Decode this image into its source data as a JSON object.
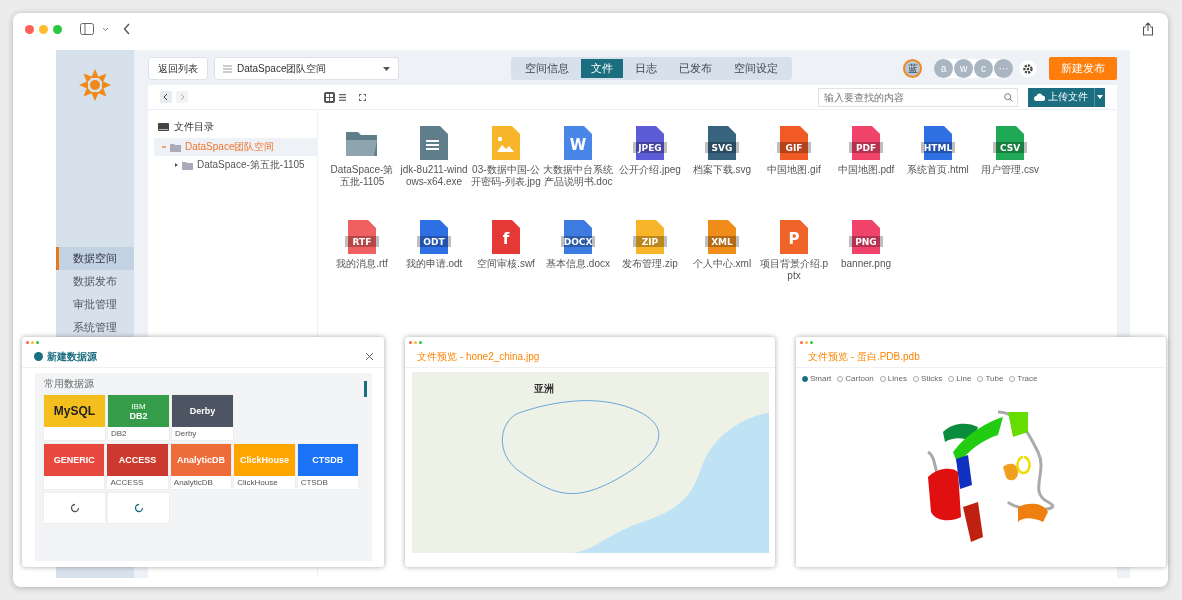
{
  "nav": {
    "items": [
      {
        "label": "数据空间",
        "selected": true
      },
      {
        "label": "数据发布",
        "selected": false
      },
      {
        "label": "审批管理",
        "selected": false
      },
      {
        "label": "系统管理",
        "selected": false
      }
    ]
  },
  "header": {
    "back_button": "返回列表",
    "space_select": "DataSpace团队空间",
    "tabs": [
      {
        "label": "空间信息",
        "selected": false
      },
      {
        "label": "文件",
        "selected": true
      },
      {
        "label": "日志",
        "selected": false
      },
      {
        "label": "已发布",
        "selected": false
      },
      {
        "label": "空间设定",
        "selected": false
      }
    ],
    "owner_avatar": "蓝",
    "members": [
      "a",
      "w",
      "c",
      "···"
    ],
    "new_button": "新建发布"
  },
  "toolbar": {
    "view_modes": [
      {
        "kind": "grid",
        "selected": true
      },
      {
        "kind": "list",
        "selected": false
      },
      {
        "kind": "compact",
        "selected": false
      }
    ],
    "search": {
      "placeholder": "输入要查找的内容"
    },
    "upload_button": "上传文件"
  },
  "tree": {
    "title": "文件目录",
    "items": [
      {
        "label": "DataSpace团队空间",
        "selected": true,
        "expanded": true,
        "children": [
          {
            "label": "DataSpace-第五批-1105",
            "selected": false,
            "expanded": false
          }
        ]
      }
    ]
  },
  "files": [
    {
      "name": "DataSpace-第五批-1105",
      "kind": "folder",
      "color": "#607d8b"
    },
    {
      "name": "jdk-8u211-windows-x64.exe",
      "kind": "text",
      "color": "#607d8b"
    },
    {
      "name": "03-数据中国-公开密码-列表.jpg",
      "kind": "image",
      "color": "#f7b529"
    },
    {
      "name": "大数据中台系统产品说明书.doc",
      "kind": "doc",
      "color": "#4a86e8",
      "badge": "W"
    },
    {
      "name": "公开介绍.jpeg",
      "kind": "image",
      "color": "#5c5cd6",
      "badge": "JPEG"
    },
    {
      "name": "档案下载.svg",
      "kind": "doc",
      "color": "#37637f",
      "badge": "SVG"
    },
    {
      "name": "中国地图.gif",
      "kind": "doc",
      "color": "#f15a24",
      "badge": "GIF"
    },
    {
      "name": "中国地图.pdf",
      "kind": "doc",
      "color": "#f0436a",
      "badge": "PDF"
    },
    {
      "name": "系统首页.html",
      "kind": "doc",
      "color": "#2f6fe4",
      "badge": "HTML"
    },
    {
      "name": "用户管理.csv",
      "kind": "doc",
      "color": "#1fa855",
      "badge": "CSV"
    },
    {
      "name": "我的消息.rtf",
      "kind": "doc",
      "color": "#f06060",
      "badge": "RTF"
    },
    {
      "name": "我的申请.odt",
      "kind": "doc",
      "color": "#2f6fe4",
      "badge": "ODT"
    },
    {
      "name": "空间审核.swf",
      "kind": "doc",
      "color": "#e53935",
      "badge": "f"
    },
    {
      "name": "基本信息.docx",
      "kind": "doc",
      "color": "#3d7be0",
      "badge": "DOCX"
    },
    {
      "name": "发布管理.zip",
      "kind": "doc",
      "color": "#f7b529",
      "badge": "ZIP"
    },
    {
      "name": "个人中心.xml",
      "kind": "doc",
      "color": "#f08c1a",
      "badge": "XML"
    },
    {
      "name": "项目背景介绍.pptx",
      "kind": "doc",
      "color": "#f0642a",
      "badge": "P"
    },
    {
      "name": "banner.png",
      "kind": "image",
      "color": "#f0436a",
      "badge": "PNG"
    }
  ],
  "datasource_window": {
    "title": "新建数据源",
    "section": "常用数据源",
    "featured_cards": [
      {
        "logo": "MySQL",
        "color": "#f4bf1d"
      },
      {
        "logo": "DB2",
        "logo_top": "IBM",
        "caption": "DB2",
        "color": "#359d49"
      },
      {
        "logo": "Derby",
        "caption": "Derby",
        "color": "#4d5562"
      }
    ],
    "other_cards": [
      {
        "logo": "GENERIC",
        "color": "#e7493f"
      },
      {
        "logo": "ACCESS",
        "caption": "ACCESS",
        "color": "#cc3a2f"
      },
      {
        "logo": "AnalyticDB",
        "caption": "AnalyticDB",
        "color": "#ee6c3a"
      },
      {
        "logo": "ClickHouse",
        "caption": "ClickHouse",
        "color": "#ffa500"
      },
      {
        "logo": "CTSDB",
        "caption": "CTSDB",
        "color": "#1a73f5"
      }
    ]
  },
  "map_window": {
    "title": "文件预览 - hone2_china.jpg",
    "map_label": "亚洲"
  },
  "protein_window": {
    "title": "文件预览 - 蛋白.PDB.pdb",
    "styles": [
      {
        "label": "Smart",
        "selected": true
      },
      {
        "label": "Cartoon",
        "selected": false
      },
      {
        "label": "Lines",
        "selected": false
      },
      {
        "label": "Sticks",
        "selected": false
      },
      {
        "label": "Line",
        "selected": false
      },
      {
        "label": "Tube",
        "selected": false
      },
      {
        "label": "Trace",
        "selected": false
      }
    ]
  }
}
